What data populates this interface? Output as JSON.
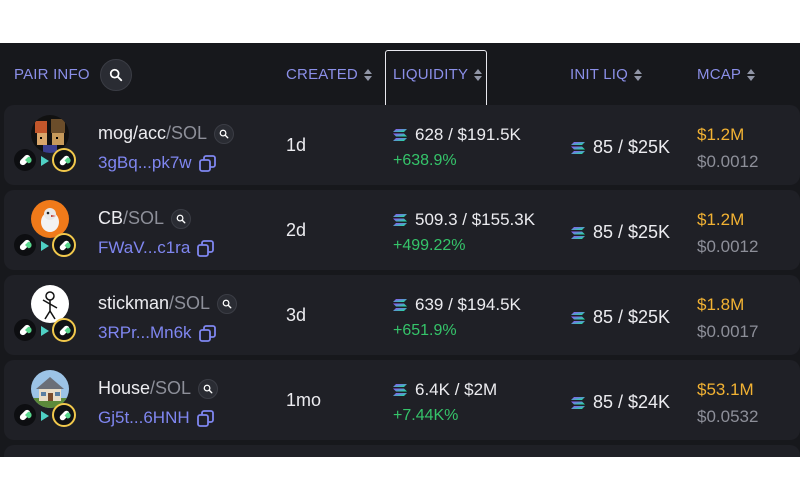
{
  "header": {
    "pair_info": "PAIR INFO",
    "created": "CREATED",
    "liquidity": "LIQUIDITY",
    "init_liq": "INIT LIQ",
    "mcap": "MCAP"
  },
  "rows": [
    {
      "avatar": "pixel-art-characters",
      "base": "mog/acc",
      "quote": "/SOL",
      "address": "3gBq...pk7w",
      "created": "1d",
      "liquidity": "628 / $191.5K",
      "liquidity_change": "+638.9%",
      "init_liq": "85 / $25K",
      "mcap": "$1.2M",
      "price": "$0.0012"
    },
    {
      "avatar": "orange-bird",
      "base": "CB",
      "quote": "/SOL",
      "address": "FWaV...c1ra",
      "created": "2d",
      "liquidity": "509.3 / $155.3K",
      "liquidity_change": "+499.22%",
      "init_liq": "85 / $25K",
      "mcap": "$1.2M",
      "price": "$0.0012"
    },
    {
      "avatar": "stick-figure",
      "base": "stickman",
      "quote": "/SOL",
      "address": "3RPr...Mn6k",
      "created": "3d",
      "liquidity": "639 / $194.5K",
      "liquidity_change": "+651.9%",
      "init_liq": "85 / $25K",
      "mcap": "$1.8M",
      "price": "$0.0017"
    },
    {
      "avatar": "house",
      "base": "House",
      "quote": "/SOL",
      "address": "Gj5t...6HNH",
      "created": "1mo",
      "liquidity": "6.4K / $2M",
      "liquidity_change": "+7.44K%",
      "init_liq": "85 / $24K",
      "mcap": "$53.1M",
      "price": "$0.0532"
    }
  ],
  "colors": {
    "background": "#17181c",
    "row": "#1f2026",
    "header_text": "#8b8fe8",
    "address": "#7f86f0",
    "positive": "#35c46a",
    "mcap": "#f2b233",
    "muted": "#8d8f99"
  }
}
